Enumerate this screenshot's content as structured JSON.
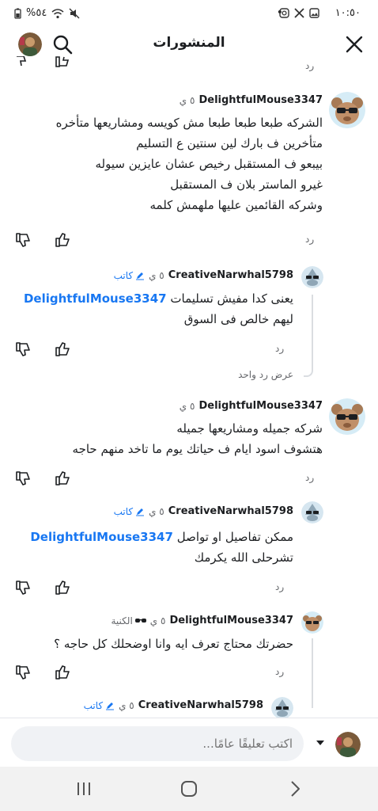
{
  "status": {
    "time": "١٠:٥٠",
    "battery": "%٥٤",
    "dot": "•"
  },
  "header": {
    "title": "المنشورات"
  },
  "top_actions": {
    "reply_label": "رد"
  },
  "comments": [
    {
      "username": "DelightfulMouse3347",
      "time": "٥ ي",
      "lines": [
        "الشركه طبعا طبعا طبعا مش كويسه ومشاريعها متأخره",
        "متأخرين ف بارك لين سنتين ع التسليم",
        "بيبعو ف المستقبل رخيص عشان عايزين سيوله",
        "غيرو الماستر بلان ف المستقبل",
        "وشركه القائمين عليها ملهمش كلمه"
      ],
      "reply_label": "رد"
    },
    {
      "username": "CreativeNarwhal5798",
      "time": "٥ ي",
      "badge": "كاتب",
      "mention": "DelightfulMouse3347",
      "line1_rest": "يعنى كدا مفيش تسليمات",
      "line2": "ليهم خالص فى السوق",
      "reply_label": "رد",
      "view_replies": "عرض رد واحد"
    },
    {
      "username": "DelightfulMouse3347",
      "time": "٥ ي",
      "lines": [
        "شركه جميله ومشاريعها جميله",
        "هتشوف اسود ايام ف حياتك يوم ما تاخد منهم حاجه"
      ],
      "reply_label": "رد"
    },
    {
      "username": "CreativeNarwhal5798",
      "time": "٥ ي",
      "badge": "كاتب",
      "mention": "DelightfulMouse3347",
      "line1_rest": "ممكن تفاصيل او تواصل",
      "line2": "تشرحلى الله يكرمك",
      "reply_label": "رد"
    },
    {
      "username": "DelightfulMouse3347",
      "time": "٥ ي",
      "badge": "الكنية",
      "lines": [
        "حضرتك محتاج تعرف ايه وانا اوضحلك كل حاجه ؟"
      ],
      "reply_label": "رد"
    },
    {
      "username": "CreativeNarwhal5798",
      "time": "٥ ي",
      "badge": "كاتب"
    }
  ],
  "composer": {
    "placeholder": "اكتب تعليقًا عامًا..."
  },
  "colors": {
    "accent": "#1877f2",
    "muted": "#65676b",
    "text": "#1c1e21",
    "input_bg": "#f0f2f5"
  }
}
